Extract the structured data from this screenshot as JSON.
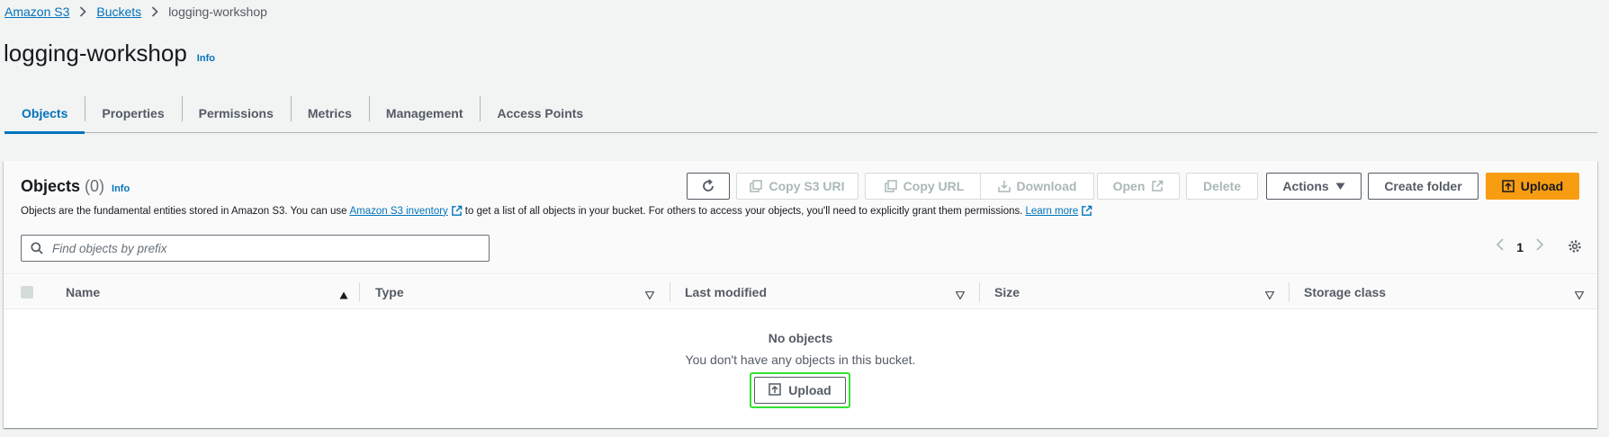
{
  "breadcrumb": {
    "items": [
      "Amazon S3",
      "Buckets"
    ],
    "current": "logging-workshop"
  },
  "page": {
    "title": "logging-workshop",
    "info": "Info"
  },
  "tabs": [
    {
      "label": "Objects",
      "active": true
    },
    {
      "label": "Properties",
      "active": false
    },
    {
      "label": "Permissions",
      "active": false
    },
    {
      "label": "Metrics",
      "active": false
    },
    {
      "label": "Management",
      "active": false
    },
    {
      "label": "Access Points",
      "active": false
    }
  ],
  "objects_panel": {
    "title": "Objects",
    "count": "(0)",
    "info": "Info",
    "description": {
      "before_link": "Objects are the fundamental entities stored in Amazon S3. You can use",
      "inventory_link": "Amazon S3 inventory",
      "middle": "to get a list of all objects in your bucket. For others to access your objects, you'll need to explicitly grant them permissions.",
      "learn_more": "Learn more"
    },
    "toolbar": {
      "copy_s3_uri": "Copy S3 URI",
      "copy_url": "Copy URL",
      "download": "Download",
      "open": "Open",
      "delete": "Delete",
      "actions": "Actions",
      "create_folder": "Create folder",
      "upload": "Upload"
    },
    "search": {
      "placeholder": "Find objects by prefix",
      "value": ""
    },
    "pagination": {
      "current_page": "1"
    },
    "columns": [
      "Name",
      "Type",
      "Last modified",
      "Size",
      "Storage class"
    ],
    "empty_state": {
      "title": "No objects",
      "message": "You don't have any objects in this bucket.",
      "upload_label": "Upload"
    }
  },
  "colors": {
    "link": "#0073bb",
    "primary_button": "#f89c12",
    "highlight": "#35e033",
    "background": "#f2f3f3"
  }
}
